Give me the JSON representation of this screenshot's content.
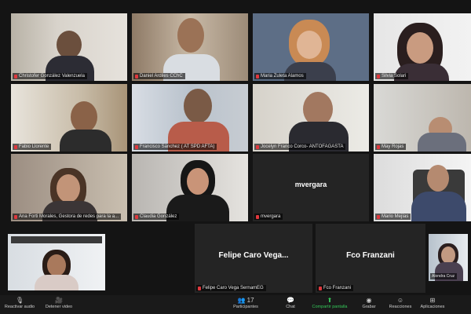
{
  "participants": [
    {
      "name": "Christofer González Valenzuela"
    },
    {
      "name": "Daniel Ardiles CChC"
    },
    {
      "name": "Maria Zuleta Alamos"
    },
    {
      "name": "Silvia Solari"
    },
    {
      "name": "Fabio Llorente"
    },
    {
      "name": "Francisco Sánchez ( AT SPD AFTA)"
    },
    {
      "name": "Jocelyn Franco Corco- ANTOFAGASTA"
    },
    {
      "name": "May Rojas"
    },
    {
      "name": "Ana Forti Morales, Gestora de redes para la a..."
    },
    {
      "name": "Claudia González"
    },
    {
      "name": "mvergara",
      "display": "mvergara"
    },
    {
      "name": "Mario Mejías"
    },
    {
      "name": "Felipe Caro Vega SernamEG",
      "display": "Felipe Caro Vega..."
    },
    {
      "name": "Fco Franzani",
      "display": "Fco Franzani"
    }
  ],
  "self_view": {
    "name": "Alondra Cruz"
  },
  "toolbar": {
    "left": [
      {
        "label": "Reactivar audio",
        "icon": "microphone-muted-icon"
      },
      {
        "label": "Detener video",
        "icon": "video-camera-icon"
      }
    ],
    "participants_count": "17",
    "center": [
      {
        "label": "Participantes",
        "icon": "participants-icon"
      },
      {
        "label": "Chat",
        "icon": "chat-icon"
      },
      {
        "label": "Compartir pantalla",
        "icon": "share-screen-icon"
      },
      {
        "label": "Grabar",
        "icon": "record-icon"
      },
      {
        "label": "Reacciones",
        "icon": "reactions-icon"
      },
      {
        "label": "Aplicaciones",
        "icon": "apps-icon"
      }
    ]
  },
  "colors": {
    "background": "#141414",
    "mic_muted": "#e0383d",
    "share_green": "#34c759"
  }
}
